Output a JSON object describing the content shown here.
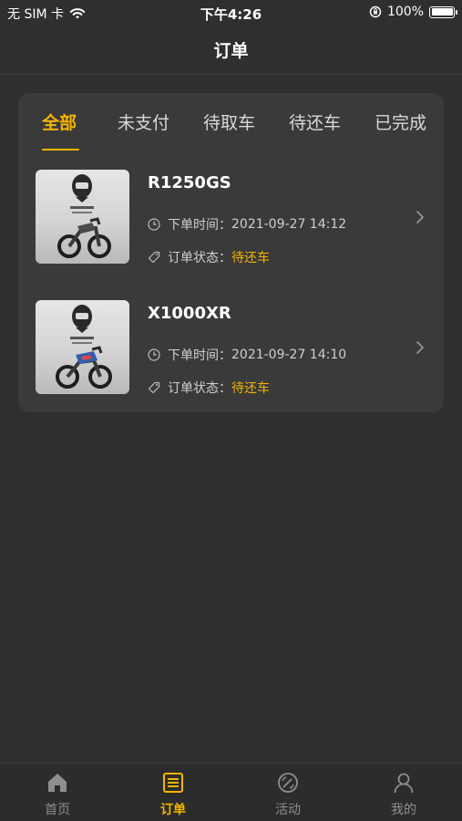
{
  "status_bar": {
    "carrier": "无 SIM 卡",
    "time": "下午4:26",
    "battery": "100%"
  },
  "nav": {
    "title": "订单"
  },
  "tabs": [
    {
      "label": "全部",
      "active": true
    },
    {
      "label": "未支付",
      "active": false
    },
    {
      "label": "待取车",
      "active": false
    },
    {
      "label": "待还车",
      "active": false
    },
    {
      "label": "已完成",
      "active": false
    }
  ],
  "orders": [
    {
      "title": "R1250GS",
      "time_label": "下单时间：",
      "time_value": "2021-09-27 14:12",
      "status_label": "订单状态：",
      "status_value": "待还车"
    },
    {
      "title": "X1000XR",
      "time_label": "下单时间：",
      "time_value": "2021-09-27 14:10",
      "status_label": "订单状态：",
      "status_value": "待还车"
    }
  ],
  "bottom_tabs": [
    {
      "label": "首页",
      "icon": "home-icon",
      "active": false
    },
    {
      "label": "订单",
      "icon": "order-icon",
      "active": true
    },
    {
      "label": "活动",
      "icon": "activity-icon",
      "active": false
    },
    {
      "label": "我的",
      "icon": "profile-icon",
      "active": false
    }
  ],
  "colors": {
    "accent": "#f5b400",
    "background": "#2f2f2f",
    "card": "#3a3a3a"
  }
}
